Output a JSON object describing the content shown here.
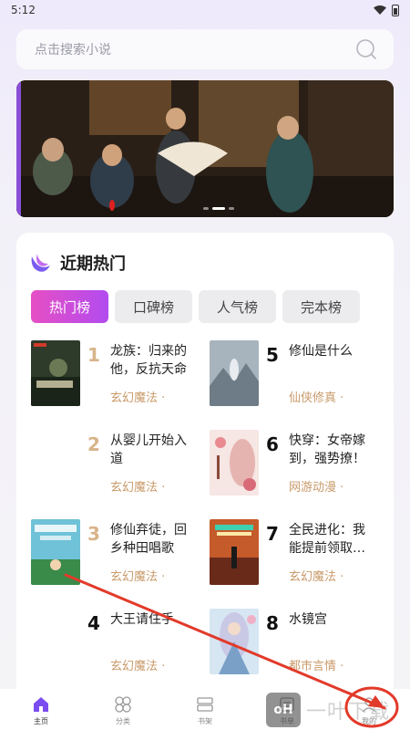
{
  "status": {
    "time": "5:12"
  },
  "search": {
    "placeholder": "点击搜索小说"
  },
  "section": {
    "title": "近期热门"
  },
  "tabs": [
    {
      "label": "热门榜",
      "active": true
    },
    {
      "label": "口碑榜",
      "active": false
    },
    {
      "label": "人气榜",
      "active": false
    },
    {
      "label": "完本榜",
      "active": false
    }
  ],
  "books": [
    {
      "rank": "1",
      "title": "龙族：归来的他，反抗天命",
      "genre": "玄幻魔法 ·"
    },
    {
      "rank": "5",
      "title": "修仙是什么",
      "genre": "仙侠修真 ·"
    },
    {
      "rank": "2",
      "title": "从婴儿开始入道",
      "genre": "玄幻魔法 ·"
    },
    {
      "rank": "6",
      "title": "快穿：女帝嫁到，强势撩！",
      "genre": "网游动漫 ·"
    },
    {
      "rank": "3",
      "title": "修仙弃徒，回乡种田唱歌",
      "genre": "玄幻魔法 ·"
    },
    {
      "rank": "7",
      "title": "全民进化：我能提前领取…",
      "genre": "玄幻魔法 ·"
    },
    {
      "rank": "4",
      "title": "大王请住手",
      "genre": "玄幻魔法 ·"
    },
    {
      "rank": "8",
      "title": "水镜宫",
      "genre": "都市言情 ·"
    }
  ],
  "nav": [
    {
      "label": "主页",
      "icon": "home-icon",
      "active": true
    },
    {
      "label": "分类",
      "icon": "category-icon",
      "active": false
    },
    {
      "label": "书架",
      "icon": "bookshelf-icon",
      "active": false
    },
    {
      "label": "书单",
      "icon": "list-icon",
      "active": false
    },
    {
      "label": "我的",
      "icon": "profile-icon",
      "active": false
    }
  ],
  "banner": {
    "slides": 3,
    "active_slide": 2
  },
  "colors": {
    "accent_start": "#e64fc4",
    "accent_end": "#b24bf0",
    "genre": "#c99a6a",
    "rank_top": "#d8b48a",
    "annotation": "#e23a2a"
  }
}
